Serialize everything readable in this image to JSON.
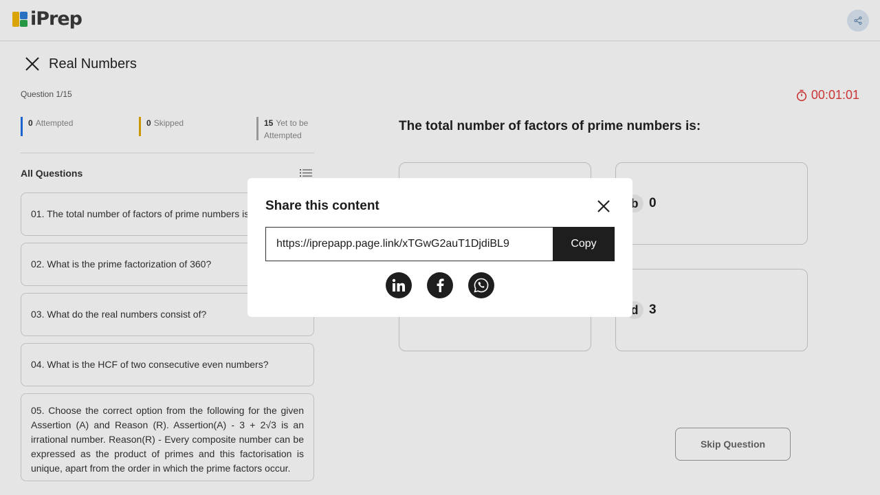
{
  "app": {
    "logo_text": "iPrep"
  },
  "header": {
    "share_icon": "share-icon"
  },
  "quiz": {
    "title": "Real Numbers",
    "question_counter": "Question 1/15",
    "stats": {
      "attempted_count": "0",
      "attempted_label": "Attempted",
      "skipped_count": "0",
      "skipped_label": "Skipped",
      "yet_count": "15",
      "yet_label": "Yet to be Attempted"
    },
    "all_questions_label": "All Questions",
    "questions": [
      "01. The total number of factors of prime numbers is:",
      "02. What is the prime factorization of 360?",
      "03. What do the real numbers consist of?",
      "04. What is the HCF of two consecutive even numbers?",
      "05. Choose the correct option from the following for the given Assertion (A) and Reason (R). Assertion(A) - 3 + 2√3 is an irrational number. Reason(R) - Every composite number can be expressed as the product of primes and this factorisation is unique, apart from the order in which the prime factors occur."
    ],
    "timer": "00:01:01",
    "current_question": "The total number of factors of prime numbers is:",
    "options": [
      {
        "letter": "b",
        "value": "0"
      },
      {
        "letter": "d",
        "value": "3"
      }
    ],
    "skip_label": "Skip Question"
  },
  "modal": {
    "title": "Share this content",
    "url": "https://iprepapp.page.link/xTGwG2auT1DjdiBL9",
    "copy_label": "Copy",
    "socials": [
      "linkedin-icon",
      "facebook-icon",
      "whatsapp-icon"
    ]
  },
  "colors": {
    "attempted": "#1e6ee8",
    "skipped": "#e0a800",
    "timer": "#e23a3a",
    "dark_button": "#1e1e1e"
  }
}
